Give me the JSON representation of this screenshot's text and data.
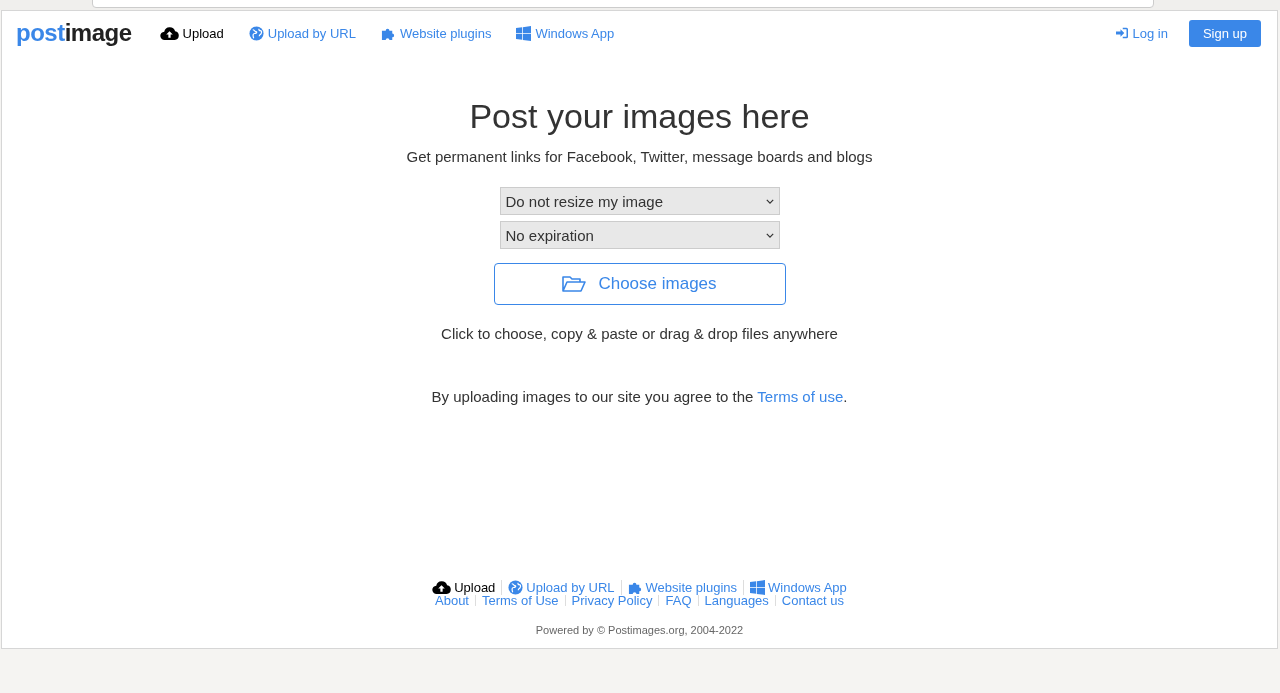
{
  "logo": {
    "part_1": "post",
    "part_2": "image"
  },
  "nav": [
    {
      "label": "Upload",
      "kind": "upload",
      "selected": true
    },
    {
      "label": "Upload by URL",
      "kind": "globe",
      "selected": false
    },
    {
      "label": "Website plugins",
      "kind": "puzzle",
      "selected": false
    },
    {
      "label": "Windows App",
      "kind": "windows",
      "selected": false
    }
  ],
  "login": "Log in",
  "signup": "Sign up",
  "heading": "Post your images here",
  "subheading": "Get permanent links for Facebook, Twitter, message boards and blogs",
  "selects": [
    "Do not resize my image",
    "No expiration"
  ],
  "choose_button": "Choose images",
  "hint": "Click to choose, copy & paste or drag & drop files anywhere",
  "terms": {
    "text": "By uploading images to our site you agree to the",
    "link": "Terms of use",
    "end": "."
  },
  "footer_nav": [
    {
      "label": "Upload",
      "kind": "upload",
      "selected": true
    },
    {
      "label": "Upload by URL",
      "kind": "globe",
      "selected": false
    },
    {
      "label": "Website plugins",
      "kind": "puzzle",
      "selected": false
    },
    {
      "label": "Windows App",
      "kind": "windows",
      "selected": false
    }
  ],
  "footer_links": [
    "About",
    "Terms of Use",
    "Privacy Policy",
    "FAQ",
    "Languages",
    "Contact us"
  ],
  "copyright": "Powered by © Postimages.org, 2004-2022"
}
